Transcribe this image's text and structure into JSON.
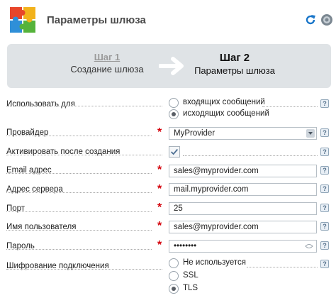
{
  "header": {
    "title": "Параметры шлюза"
  },
  "steps": {
    "step1": {
      "number": "Шаг 1",
      "name": "Создание шлюза"
    },
    "step2": {
      "number": "Шаг 2",
      "name": "Параметры шлюза"
    }
  },
  "form": {
    "use_for": {
      "label": "Использовать для",
      "options": [
        "входящих сообщений",
        "исходящих сообщений"
      ],
      "selected": "исходящих сообщений"
    },
    "provider": {
      "label": "Провайдер",
      "value": "MyProvider"
    },
    "activate": {
      "label": "Активировать после создания",
      "checked": true
    },
    "email": {
      "label": "Email адрес",
      "value": "sales@myprovider.com"
    },
    "server": {
      "label": "Адрес сервера",
      "value": "mail.myprovider.com"
    },
    "port": {
      "label": "Порт",
      "value": "25"
    },
    "username": {
      "label": "Имя пользователя",
      "value": "sales@myprovider.com"
    },
    "password": {
      "label": "Пароль",
      "value": "••••••••"
    },
    "encryption": {
      "label": "Шифрование подключения",
      "options": [
        "Не используется",
        "SSL",
        "TLS"
      ],
      "selected": "TLS"
    }
  },
  "help_symbol": "?",
  "required_symbol": "*",
  "colors": {
    "required": "#d4000a",
    "step_bar": "#dfe3e6"
  }
}
